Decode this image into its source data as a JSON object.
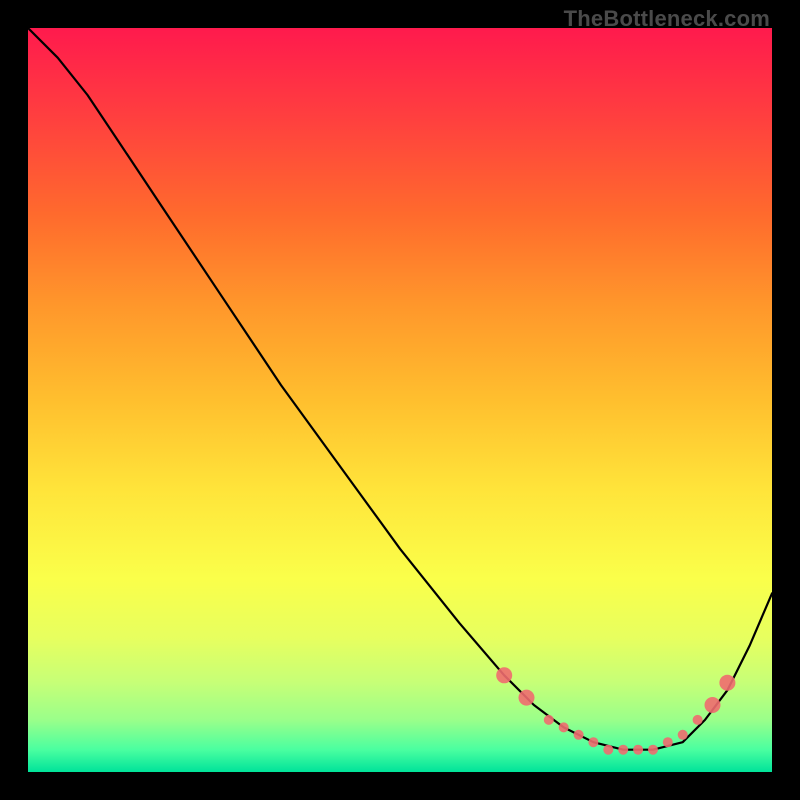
{
  "attribution": "TheBottleneck.com",
  "chart_data": {
    "type": "line",
    "title": "",
    "xlabel": "",
    "ylabel": "",
    "xlim": [
      0,
      100
    ],
    "ylim": [
      0,
      100
    ],
    "series": [
      {
        "name": "curve",
        "x": [
          0,
          4,
          8,
          12,
          18,
          26,
          34,
          42,
          50,
          58,
          64,
          68,
          72,
          76,
          80,
          84,
          88,
          91,
          94,
          97,
          100
        ],
        "y": [
          100,
          96,
          91,
          85,
          76,
          64,
          52,
          41,
          30,
          20,
          13,
          9,
          6,
          4,
          3,
          3,
          4,
          7,
          11,
          17,
          24
        ]
      }
    ],
    "markers": {
      "name": "valley-dots",
      "x": [
        64,
        67,
        70,
        72,
        74,
        76,
        78,
        80,
        82,
        84,
        86,
        88,
        90,
        92,
        94
      ],
      "y": [
        13,
        10,
        7,
        6,
        5,
        4,
        3,
        3,
        3,
        3,
        4,
        5,
        7,
        9,
        12
      ],
      "radius_small": 5,
      "radius_large": 8
    },
    "background_gradient": {
      "top": "#ff1a4d",
      "bottom": "#00e39a"
    }
  }
}
